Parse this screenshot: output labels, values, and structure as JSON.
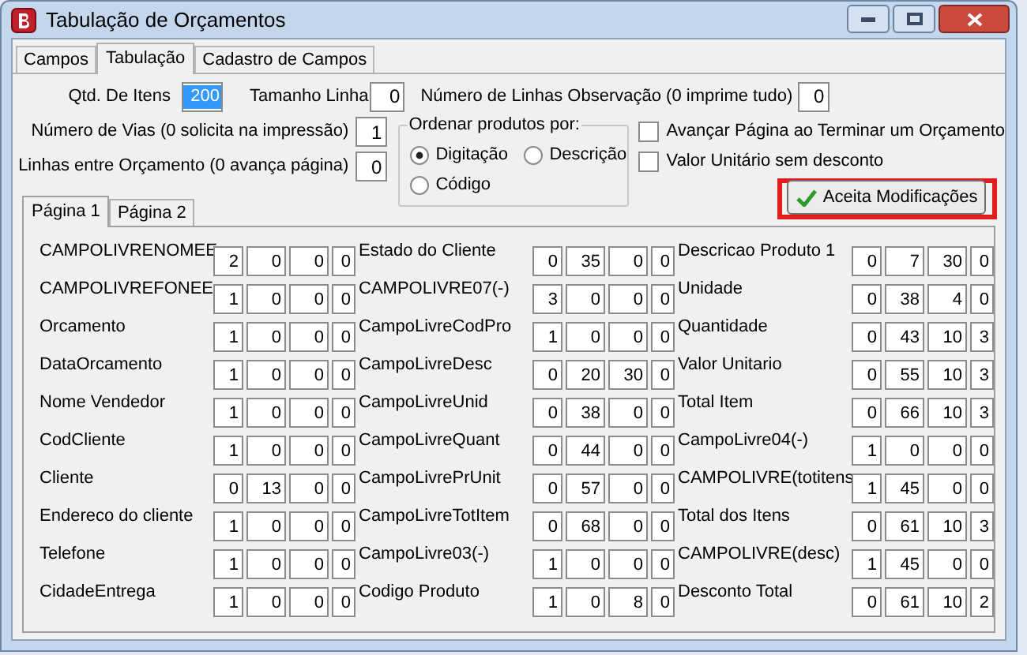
{
  "window": {
    "title": "Tabulação de Orçamentos"
  },
  "tabs": [
    {
      "label": "Campos",
      "selected": false
    },
    {
      "label": "Tabulação",
      "selected": true
    },
    {
      "label": "Cadastro de Campos",
      "selected": false
    }
  ],
  "settings": {
    "qtd_itens": {
      "label": "Qtd. De Itens",
      "value": "200",
      "selected": true
    },
    "tamanho_linha": {
      "label": "Tamanho Linha",
      "value": "0"
    },
    "linhas_observacao": {
      "label": "Número de Linhas Observação (0 imprime tudo)",
      "value": "0"
    },
    "numero_vias": {
      "label": "Número de Vias (0 solicita na impressão)",
      "value": "1"
    },
    "linhas_entre": {
      "label": "Linhas entre Orçamento (0 avança página)",
      "value": "0"
    }
  },
  "order_group": {
    "title": "Ordenar produtos por:",
    "options": [
      {
        "label": "Digitação",
        "selected": true
      },
      {
        "label": "Descrição",
        "selected": false
      },
      {
        "label": "Código",
        "selected": false
      }
    ]
  },
  "checkboxes": [
    {
      "label": "Avançar Página ao Terminar um Orçamento",
      "checked": false
    },
    {
      "label": "Valor Unitário sem desconto",
      "checked": false
    }
  ],
  "accept_button": {
    "label": "Aceita Modificações",
    "highlighted": true
  },
  "page_tabs": [
    {
      "label": "Página 1",
      "selected": true
    },
    {
      "label": "Página 2",
      "selected": false
    }
  ],
  "columns": [
    {
      "fields": [
        {
          "label": "CAMPOLIVRENOMEE",
          "values": [
            "2",
            "0",
            "0",
            "0"
          ]
        },
        {
          "label": "CAMPOLIVREFONEE",
          "values": [
            "1",
            "0",
            "0",
            "0"
          ]
        },
        {
          "label": "Orcamento",
          "values": [
            "1",
            "0",
            "0",
            "0"
          ]
        },
        {
          "label": "DataOrcamento",
          "values": [
            "1",
            "0",
            "0",
            "0"
          ]
        },
        {
          "label": "Nome Vendedor",
          "values": [
            "1",
            "0",
            "0",
            "0"
          ]
        },
        {
          "label": "CodCliente",
          "values": [
            "1",
            "0",
            "0",
            "0"
          ]
        },
        {
          "label": "Cliente",
          "values": [
            "0",
            "13",
            "0",
            "0"
          ]
        },
        {
          "label": "Endereco do cliente",
          "values": [
            "1",
            "0",
            "0",
            "0"
          ]
        },
        {
          "label": "Telefone",
          "values": [
            "1",
            "0",
            "0",
            "0"
          ]
        },
        {
          "label": "CidadeEntrega",
          "values": [
            "1",
            "0",
            "0",
            "0"
          ]
        }
      ]
    },
    {
      "fields": [
        {
          "label": "Estado do Cliente",
          "values": [
            "0",
            "35",
            "0",
            "0"
          ]
        },
        {
          "label": "CAMPOLIVRE07(-)",
          "values": [
            "3",
            "0",
            "0",
            "0"
          ]
        },
        {
          "label": "CampoLivreCodPro",
          "values": [
            "1",
            "0",
            "0",
            "0"
          ]
        },
        {
          "label": "CampoLivreDesc",
          "values": [
            "0",
            "20",
            "30",
            "0"
          ]
        },
        {
          "label": "CampoLivreUnid",
          "values": [
            "0",
            "38",
            "0",
            "0"
          ]
        },
        {
          "label": "CampoLivreQuant",
          "values": [
            "0",
            "44",
            "0",
            "0"
          ]
        },
        {
          "label": "CampoLivrePrUnit",
          "values": [
            "0",
            "57",
            "0",
            "0"
          ]
        },
        {
          "label": "CampoLivreTotItem",
          "values": [
            "0",
            "68",
            "0",
            "0"
          ]
        },
        {
          "label": "CampoLivre03(-)",
          "values": [
            "1",
            "0",
            "0",
            "0"
          ]
        },
        {
          "label": "Codigo Produto",
          "values": [
            "1",
            "0",
            "8",
            "0"
          ]
        }
      ]
    },
    {
      "fields": [
        {
          "label": "Descricao Produto 1",
          "values": [
            "0",
            "7",
            "30",
            "0"
          ]
        },
        {
          "label": "Unidade",
          "values": [
            "0",
            "38",
            "4",
            "0"
          ]
        },
        {
          "label": "Quantidade",
          "values": [
            "0",
            "43",
            "10",
            "3"
          ]
        },
        {
          "label": "Valor Unitario",
          "values": [
            "0",
            "55",
            "10",
            "3"
          ]
        },
        {
          "label": "Total Item",
          "values": [
            "0",
            "66",
            "10",
            "3"
          ]
        },
        {
          "label": "CampoLivre04(-)",
          "values": [
            "1",
            "0",
            "0",
            "0"
          ]
        },
        {
          "label": "CAMPOLIVRE(totitens",
          "values": [
            "1",
            "45",
            "0",
            "0"
          ]
        },
        {
          "label": "Total dos Itens",
          "values": [
            "0",
            "61",
            "10",
            "3"
          ]
        },
        {
          "label": "CAMPOLIVRE(desc)",
          "values": [
            "1",
            "45",
            "0",
            "0"
          ]
        },
        {
          "label": "Desconto Total",
          "values": [
            "0",
            "61",
            "10",
            "2"
          ]
        }
      ]
    }
  ]
}
